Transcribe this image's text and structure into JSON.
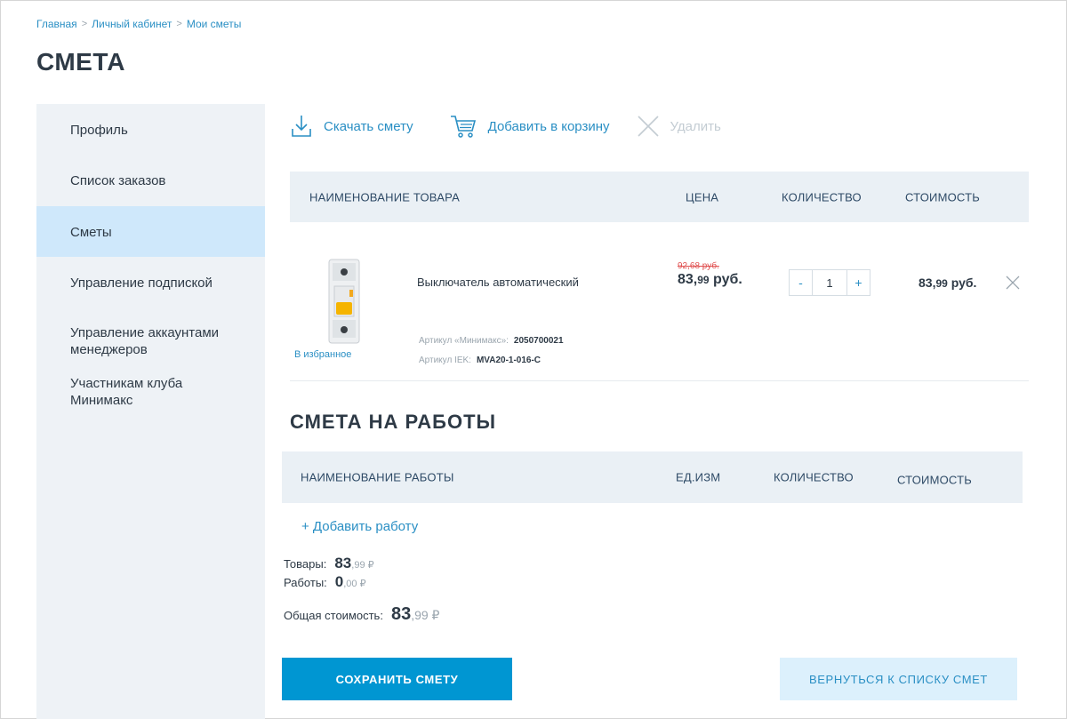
{
  "breadcrumb": [
    "Главная",
    "Личный кабинет",
    "Мои сметы"
  ],
  "page_title": "СМЕТА",
  "sidebar": {
    "items": [
      {
        "label": "Профиль"
      },
      {
        "label": "Список заказов"
      },
      {
        "label": "Сметы",
        "active": true
      },
      {
        "label": "Управление подпиской"
      },
      {
        "label": "Управление аккаунтами менеджеров"
      },
      {
        "label": "Участникам клуба Минимакс"
      }
    ]
  },
  "toolbar": {
    "download": "Скачать смету",
    "add_to_cart": "Добавить в корзину",
    "delete": "Удалить"
  },
  "products_table": {
    "headers": {
      "name": "НАИМЕНОВАНИЕ ТОВАРА",
      "price": "ЦЕНА",
      "qty": "КОЛИЧЕСТВО",
      "cost": "СТОИМОСТЬ"
    },
    "rows": [
      {
        "name": "Выключатель автоматический",
        "favorite_link": "В избранное",
        "sku_minimax_label": "Артикул «Минимакс»:",
        "sku_minimax": "2050700021",
        "sku_iek_label": "Артикул IEK:",
        "sku_iek": "MVA20-1-016-C",
        "old_price": "92,68 руб.",
        "price_int": "83,",
        "price_dec": "99",
        "price_unit": " руб.",
        "qty_minus": "-",
        "qty": "1",
        "qty_plus": "+",
        "cost_int": "83,",
        "cost_dec": "99",
        "cost_unit": " руб."
      }
    ]
  },
  "works": {
    "title": "СМЕТА НА РАБОТЫ",
    "headers": {
      "name": "НАИМЕНОВАНИЕ РАБОТЫ",
      "unit": "ЕД.ИЗМ",
      "qty": "КОЛИЧЕСТВО",
      "cost": "СТОИМОСТЬ"
    },
    "add_label": "+ Добавить работу"
  },
  "summary": {
    "goods_label": "Товары:",
    "goods_int": "83",
    "goods_dec": ",99 ₽",
    "works_label": "Работы:",
    "works_int": "0",
    "works_dec": ",00 ₽",
    "total_label": "Общая стоимость:",
    "total_int": "83",
    "total_dec": ",99 ₽"
  },
  "buttons": {
    "save": "СОХРАНИТЬ СМЕТУ",
    "back": "ВЕРНУТЬСЯ К СПИСКУ СМЕТ"
  },
  "colors": {
    "accent": "#0096d2",
    "link": "#2a8fc4",
    "sidebar_bg": "#eef2f6",
    "active_bg": "#cfe8fb",
    "old_price": "#e05050"
  }
}
